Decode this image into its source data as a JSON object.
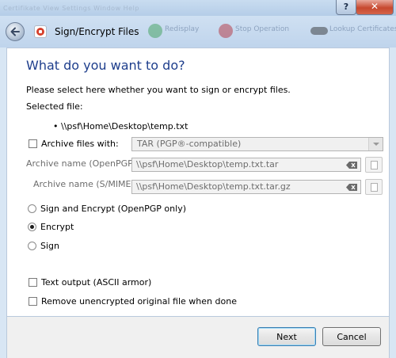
{
  "titlebar": {
    "faded_menu": "Certifikate   View   Settings   Window   Help",
    "help_label": "?",
    "close_label": "✕"
  },
  "nav": {
    "title": "Sign/Encrypt Files",
    "ghost_items": [
      "Redisplay",
      "Stop Operation",
      "Lookup Certificates"
    ]
  },
  "page": {
    "heading": "What do you want to do?",
    "instruction": "Please select here whether you want to sign or encrypt files.",
    "selected_file_label": "Selected file:",
    "selected_file": "\\\\psf\\Home\\Desktop\\temp.txt",
    "archive": {
      "label": "Archive files with:",
      "checked": false,
      "format": "TAR (PGP®-compatible)"
    },
    "archive_openpgp": {
      "label": "Archive name (OpenPGP):",
      "value": "\\\\psf\\Home\\Desktop\\temp.txt.tar"
    },
    "archive_smime": {
      "label": "Archive name (S/MIME):",
      "value": "\\\\psf\\Home\\Desktop\\temp.txt.tar.gz"
    },
    "options": [
      {
        "label": "Sign and Encrypt (OpenPGP only)",
        "selected": false
      },
      {
        "label": "Encrypt",
        "selected": true
      },
      {
        "label": "Sign",
        "selected": false
      }
    ],
    "text_output": {
      "label": "Text output (ASCII armor)",
      "checked": false
    },
    "remove_original": {
      "label": "Remove unencrypted original file when done",
      "checked": false
    }
  },
  "buttons": {
    "next": "Next",
    "cancel": "Cancel"
  },
  "colors": {
    "heading": "#1e3e8c",
    "chrome": "#c9dcf0",
    "close": "#c7492f"
  }
}
